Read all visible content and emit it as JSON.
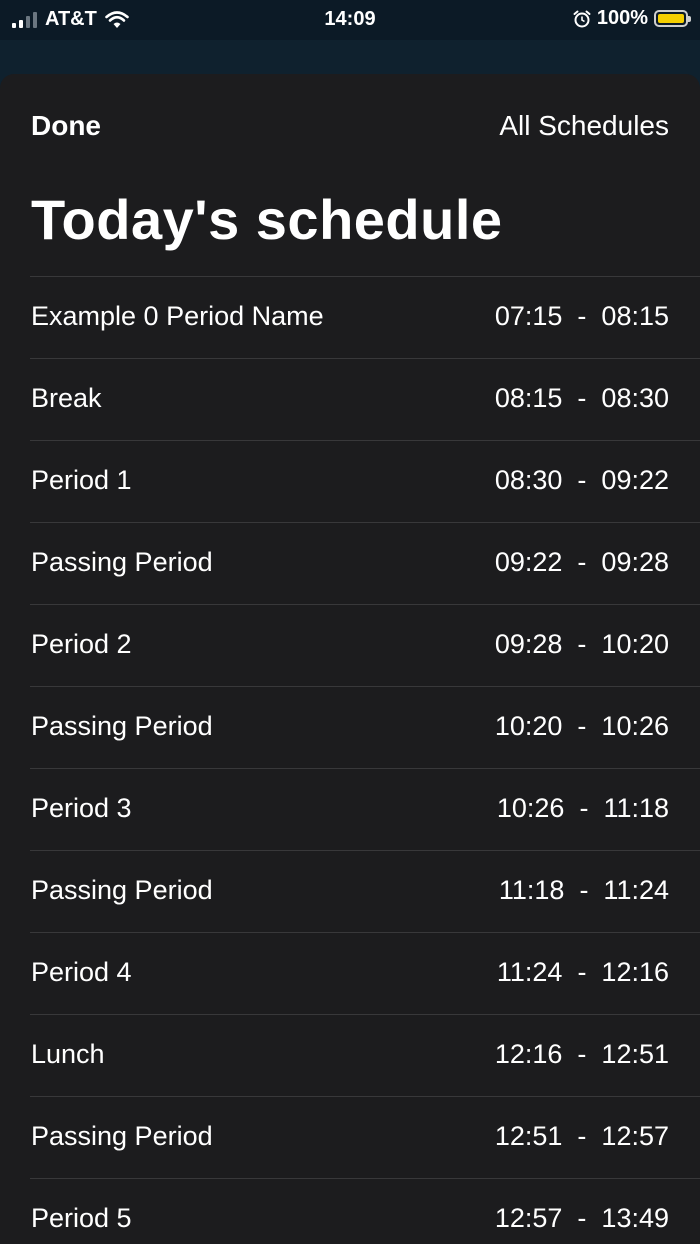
{
  "status_bar": {
    "carrier": "AT&T",
    "time": "14:09",
    "battery": "100%",
    "battery_color": "#f5cf00"
  },
  "nav": {
    "done_label": "Done",
    "all_schedules_label": "All Schedules"
  },
  "title": "Today's schedule",
  "periods": [
    {
      "name": "Example 0 Period Name",
      "time": "07:15  -  08:15"
    },
    {
      "name": "Break",
      "time": "08:15  -  08:30"
    },
    {
      "name": "Period 1",
      "time": "08:30  -  09:22"
    },
    {
      "name": "Passing Period",
      "time": "09:22  -  09:28"
    },
    {
      "name": "Period 2",
      "time": "09:28  -  10:20"
    },
    {
      "name": "Passing Period",
      "time": "10:20  -  10:26"
    },
    {
      "name": "Period 3",
      "time": "10:26  -  11:18"
    },
    {
      "name": "Passing Period",
      "time": "11:18  -  11:24"
    },
    {
      "name": "Period 4",
      "time": "11:24  -  12:16"
    },
    {
      "name": "Lunch",
      "time": "12:16  -  12:51"
    },
    {
      "name": "Passing Period",
      "time": "12:51  -  12:57"
    },
    {
      "name": "Period 5",
      "time": "12:57  -  13:49"
    }
  ]
}
